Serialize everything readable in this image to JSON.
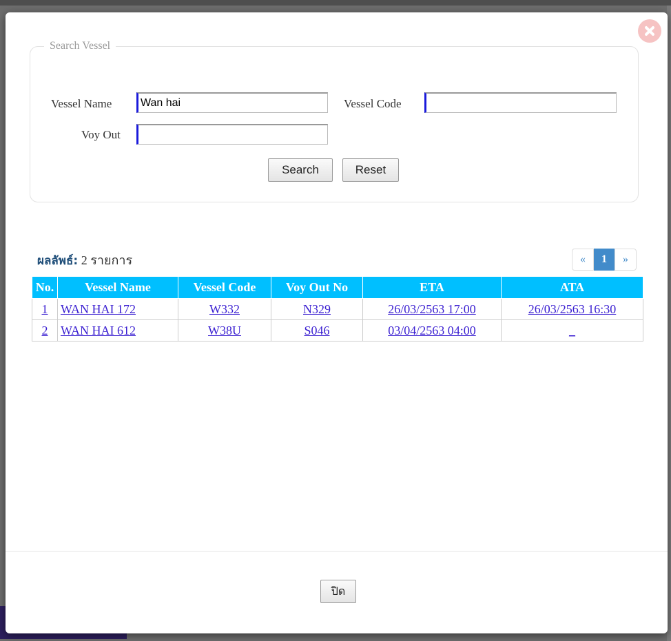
{
  "search": {
    "legend": "Search Vessel",
    "vessel_name_label": "Vessel Name",
    "vessel_name_value": "Wan hai",
    "vessel_code_label": "Vessel Code",
    "vessel_code_value": "",
    "voy_out_label": "Voy Out",
    "voy_out_value": "",
    "search_button": "Search",
    "reset_button": "Reset"
  },
  "results": {
    "label_prefix": "ผลลัพธ์:",
    "label_count": " 2 รายการ",
    "pager": {
      "prev": "«",
      "current": "1",
      "next": "»"
    },
    "columns": [
      "No.",
      "Vessel Name",
      "Vessel Code",
      "Voy Out No",
      "ETA",
      "ATA"
    ],
    "rows": [
      {
        "no": "1",
        "vessel_name": "WAN HAI 172",
        "vessel_code": "W332",
        "voy_out": "N329",
        "eta": "26/03/2563 17:00",
        "ata": "26/03/2563 16:30"
      },
      {
        "no": "2",
        "vessel_name": "WAN HAI 612",
        "vessel_code": "W38U",
        "voy_out": "S046",
        "eta": "03/04/2563 04:00",
        "ata": "_"
      }
    ]
  },
  "footer": {
    "close_button": "ปิด"
  },
  "colors": {
    "header_bg": "#00bfff",
    "link": "#3a1fd1",
    "pager_active": "#428bca"
  }
}
